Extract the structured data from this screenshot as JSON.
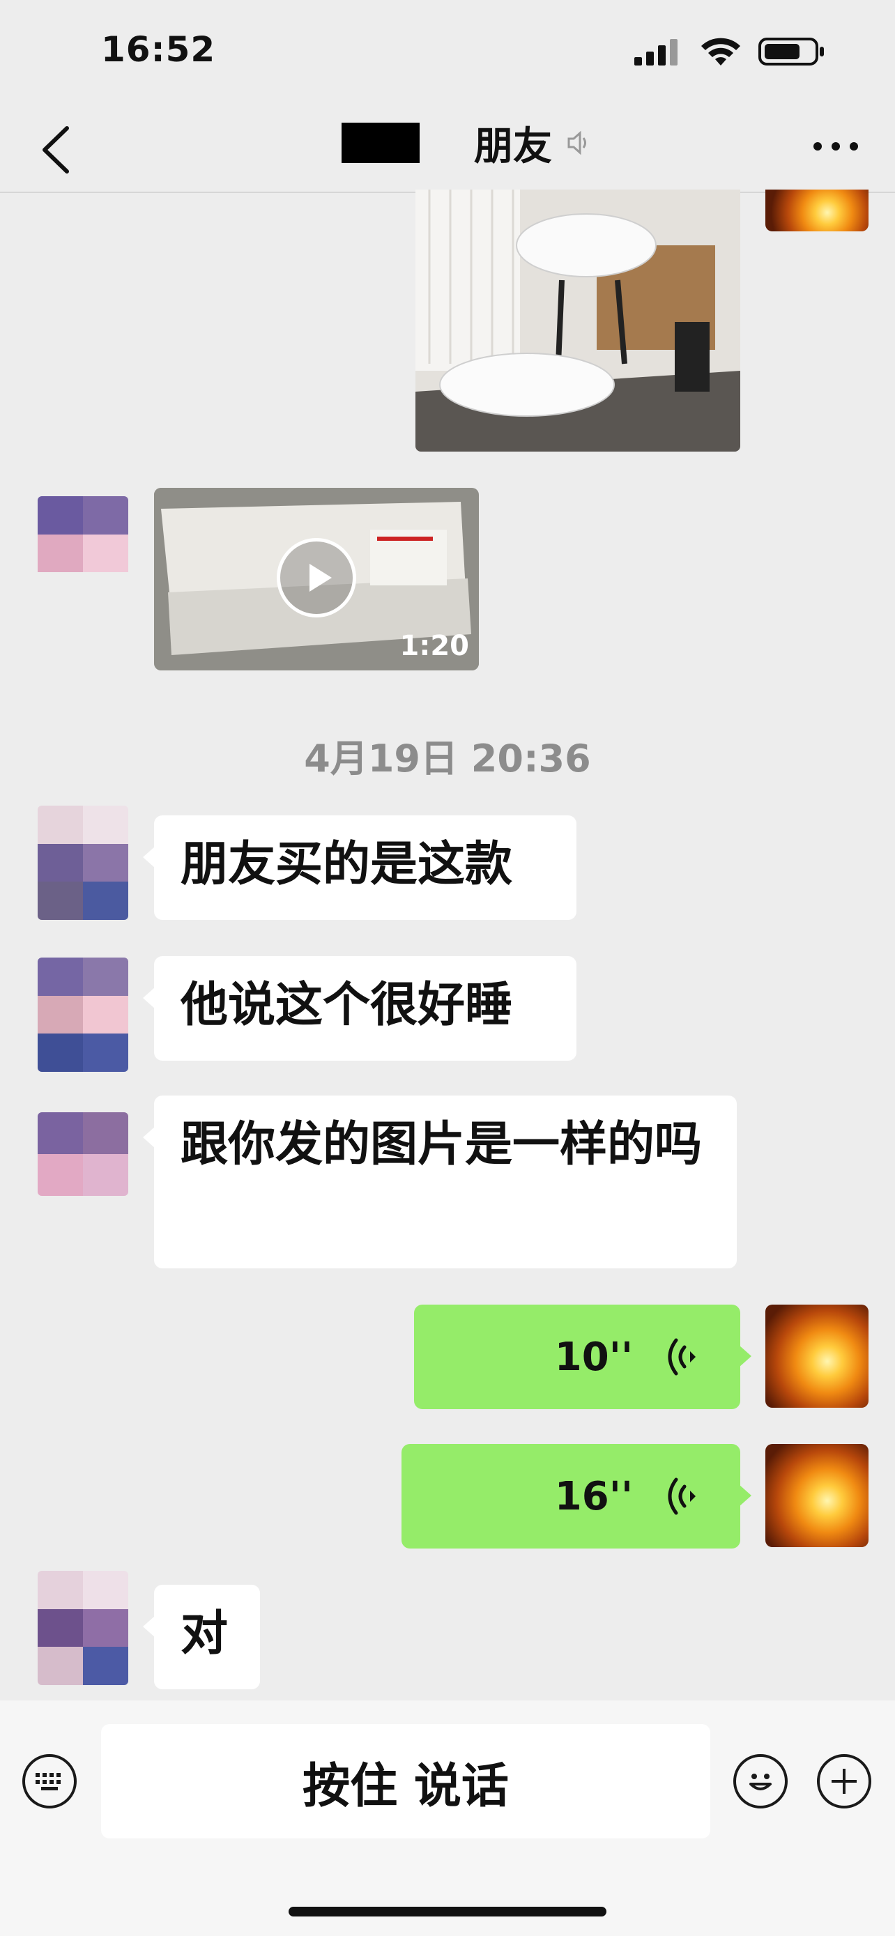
{
  "status_bar": {
    "time": "16:52"
  },
  "nav": {
    "title": "朋友",
    "back_icon": "chevron-left-icon",
    "more_icon": "ellipsis-icon"
  },
  "video": {
    "duration": "1:20"
  },
  "timestamp": "4月19日 20:36",
  "messages": [
    {
      "text": "朋友买的是这款"
    },
    {
      "text": "他说这个很好睡"
    },
    {
      "text": "跟你发的图片是一样的吗"
    },
    {
      "text": "对"
    }
  ],
  "voice_messages": [
    {
      "duration": "10''"
    },
    {
      "duration": "16''"
    }
  ],
  "input_bar": {
    "hold_to_talk": "按住 说话"
  },
  "colors": {
    "background": "#ededed",
    "my_bubble": "#95ec69",
    "other_bubble": "#ffffff"
  }
}
